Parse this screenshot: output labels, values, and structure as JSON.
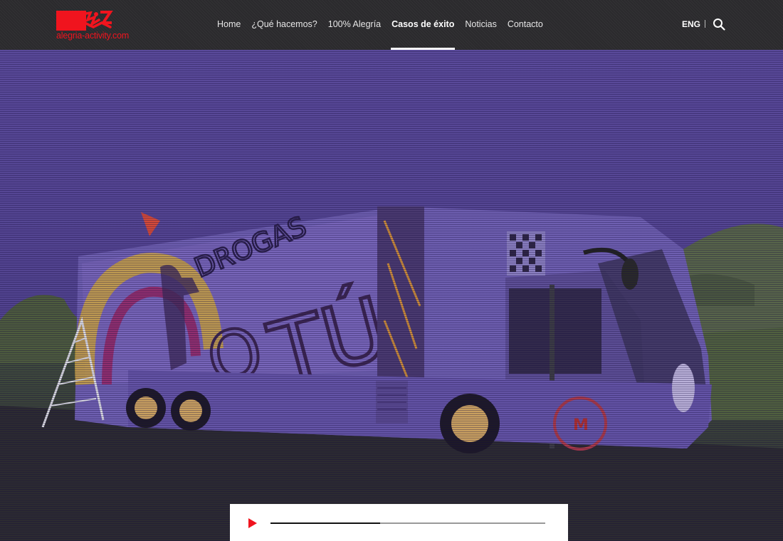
{
  "header": {
    "logo_text": "alegria-activity.com",
    "nav": [
      {
        "label": "Home",
        "active": false
      },
      {
        "label": "¿Qué hacemos?",
        "active": false
      },
      {
        "label": "100% Alegría",
        "active": false
      },
      {
        "label": "Casos de éxito",
        "active": true
      },
      {
        "label": "Noticias",
        "active": false
      },
      {
        "label": "Contacto",
        "active": false
      }
    ],
    "lang_label": "ENG",
    "search_icon": "search-icon"
  },
  "hero": {
    "image": "purple-tinted photo of a decorated bus",
    "bus_graphics": {
      "word_drogas": "DROGAS",
      "word_o": "O",
      "word_tu": "TÚ",
      "emblem": "M"
    }
  },
  "player": {
    "play_icon": "play-icon",
    "progress": 0.4
  },
  "colors": {
    "brand_red": "#f0141e",
    "header_bg": "#2b2a2d",
    "hero_tint": "#5a3e8e"
  }
}
